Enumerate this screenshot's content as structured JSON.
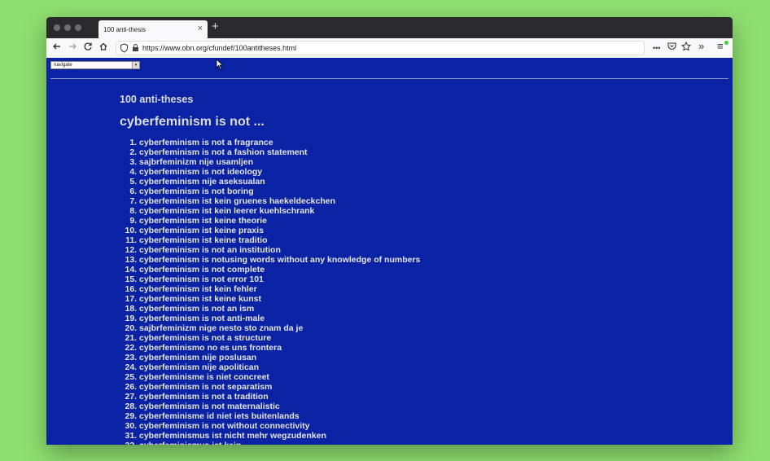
{
  "tab": {
    "title": "100 anti-thesis",
    "close": "×",
    "new_tab": "+"
  },
  "address_bar": {
    "url": "https://www.obn.org/cfundef/100antitheses.html"
  },
  "toolbar": {
    "more": "•••",
    "overflow": "»",
    "menu": "≡"
  },
  "page": {
    "navigate_label": "navigate",
    "heading_small": "100 anti-theses",
    "heading_large": "cyberfeminism is not ...",
    "items": [
      "cyberfeminism is not a fragrance",
      "cyberfeminism is not a fashion statement",
      "sajbrfeminizm nije usamljen",
      "cyberfeminism is not ideology",
      "cyberfeminism nije aseksualan",
      "cyberfeminism is not boring",
      "cyberfeminism ist kein gruenes haekeldeckchen",
      "cyberfeminism ist kein leerer kuehlschrank",
      "cyberfeminism ist keine theorie",
      "cyberfeminism ist keine praxis",
      "cyberfeminism ist keine traditio",
      "cyberfeminism is not an institution",
      "cyberfeminism is notusing words without any knowledge of numbers",
      "cyberfeminism is not complete",
      "cyberfeminism is not error 101",
      "cyberfeminism ist kein fehler",
      "cyberfeminism ist keine kunst",
      "cyberfeminism is not an ism",
      "cyberfeminism is not anti-male",
      "sajbrfeminizm nige nesto sto znam da je",
      "cyberfeminism is not a structure",
      "cyberfeminismo no es uns frontera",
      "cyberfeminism nije poslusan",
      "cyberfeminism nije apolitican",
      "cyberfeminisme is niet concreet",
      "cyberfeminism is not separatism",
      "cyberfeminism is not a tradition",
      "cyberfeminism is not maternalistic",
      "cyberfeminisme id niet iets buitenlands",
      "cyberfeminism is not without connectivity",
      "cyberfeminismus ist nicht mehr wegzudenken",
      "cyberfeminismus ist kein ..."
    ]
  },
  "colors": {
    "page_bg": "#0a23a4",
    "desktop_bg": "#8fe070",
    "chrome": "#2a2a2e"
  }
}
